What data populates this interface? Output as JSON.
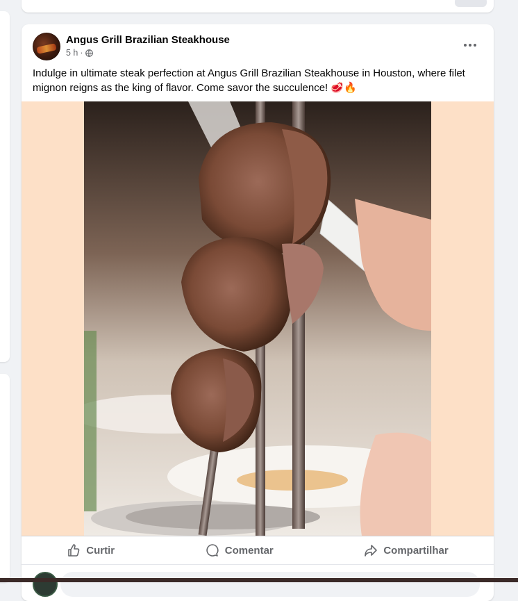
{
  "post": {
    "page_name": "Angus Grill Brazilian Steakhouse",
    "time": "5 h",
    "separator": "·",
    "privacy_icon": "globe-icon",
    "more_icon": "more-options-icon",
    "text": "Indulge in ultimate steak perfection at Angus Grill Brazilian Steakhouse in Houston, where filet mignon reigns as the king of flavor. Come savor the succulence! 🥩🔥"
  },
  "actions": {
    "like": {
      "label": "Curtir",
      "icon": "thumbs-up-icon"
    },
    "comment": {
      "label": "Comentar",
      "icon": "comment-bubble-icon"
    },
    "share": {
      "label": "Compartilhar",
      "icon": "share-arrow-icon"
    }
  },
  "colors": {
    "page_bg": "#f0f2f5",
    "card_bg": "#ffffff",
    "media_bg": "#fde0c7",
    "secondary_text": "#65676b"
  }
}
